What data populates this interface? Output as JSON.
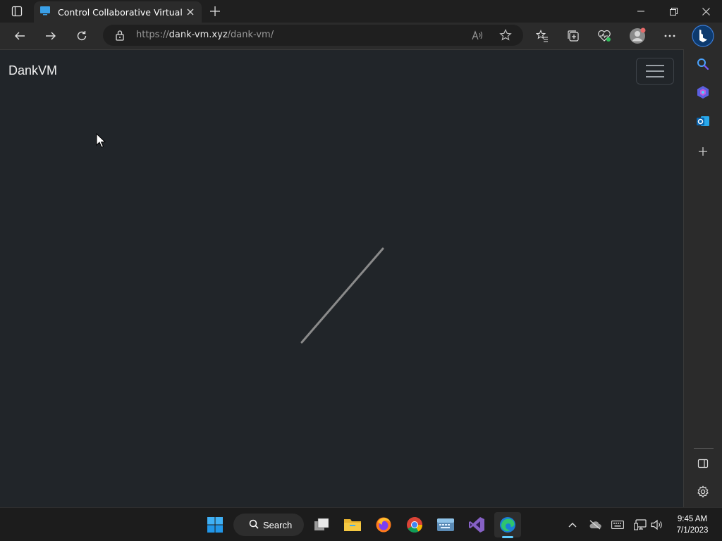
{
  "browser": {
    "tab": {
      "title": "Control Collaborative Virtual Ma",
      "icon": "monitor-icon"
    },
    "address": {
      "scheme": "https://",
      "host": "dank-vm.xyz",
      "path": "/dank-vm/"
    }
  },
  "page": {
    "brand": "DankVM",
    "menu_icon": "hamburger-icon"
  },
  "sidebar": {
    "items": [
      "search-icon",
      "copilot-icon",
      "outlook-icon",
      "add-icon"
    ],
    "bottom": [
      "sidebar-toggle-icon",
      "settings-icon"
    ]
  },
  "taskbar": {
    "search_label": "Search",
    "apps": [
      "windows-start-icon",
      "task-view-icon",
      "file-explorer-icon",
      "firefox-icon",
      "chrome-icon",
      "touch-keyboard-app-icon",
      "visual-studio-icon",
      "edge-icon"
    ],
    "clock": {
      "time": "9:45 AM",
      "date": "7/1/2023"
    }
  },
  "colors": {
    "page_bg": "#212529",
    "chrome_bg": "#2b2b2b",
    "accent": "#60cdff"
  }
}
